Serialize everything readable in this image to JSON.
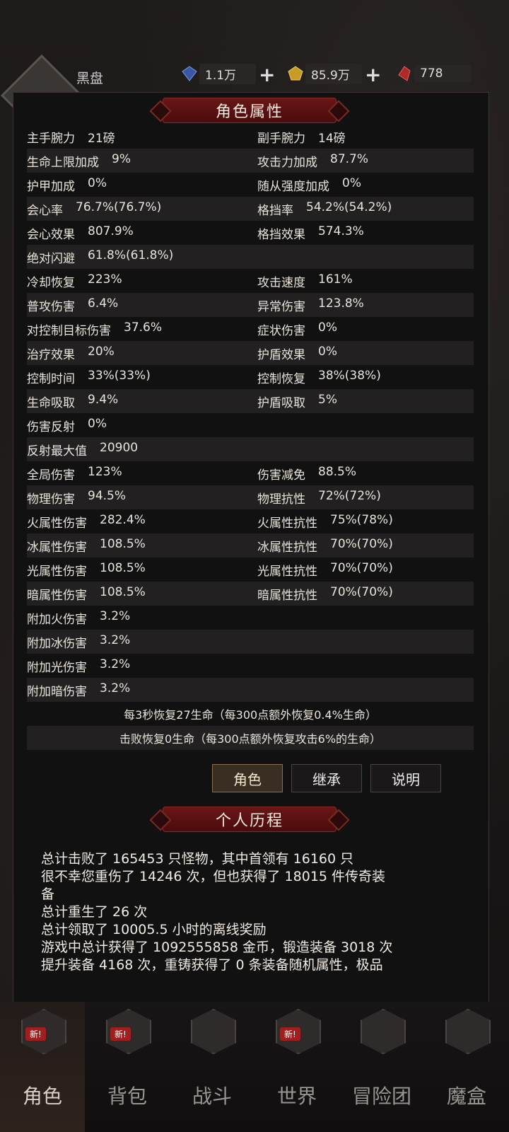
{
  "header": {
    "player_name": "黑盘",
    "currency": [
      {
        "icon": "blue-gem-icon",
        "value": "1.1万"
      },
      {
        "icon": "gold-coin-icon",
        "value": "85.9万"
      },
      {
        "icon": "red-gem-icon",
        "value": "778"
      }
    ]
  },
  "attributes_title": "角色属性",
  "stats": [
    {
      "l": "主手腕力",
      "lv": "21磅",
      "r": "副手腕力",
      "rv": "14磅"
    },
    {
      "l": "生命上限加成",
      "lv": "9%",
      "r": "攻击力加成",
      "rv": "87.7%"
    },
    {
      "l": "护甲加成",
      "lv": "0%",
      "r": "随从强度加成",
      "rv": "0%"
    },
    {
      "l": "会心率",
      "lv": "76.7%(76.7%)",
      "r": "格挡率",
      "rv": "54.2%(54.2%)"
    },
    {
      "l": "会心效果",
      "lv": "807.9%",
      "r": "格挡效果",
      "rv": "574.3%"
    },
    {
      "l": "绝对闪避",
      "lv": "61.8%(61.8%)",
      "r": "",
      "rv": ""
    },
    {
      "l": "冷却恢复",
      "lv": "223%",
      "r": "攻击速度",
      "rv": "161%"
    },
    {
      "l": "普攻伤害",
      "lv": "6.4%",
      "r": "异常伤害",
      "rv": "123.8%"
    },
    {
      "l": "对控制目标伤害",
      "lv": "37.6%",
      "r": "症状伤害",
      "rv": "0%"
    },
    {
      "l": "治疗效果",
      "lv": "20%",
      "r": "护盾效果",
      "rv": "0%"
    },
    {
      "l": "控制时间",
      "lv": "33%(33%)",
      "r": "控制恢复",
      "rv": "38%(38%)"
    },
    {
      "l": "生命吸取",
      "lv": "9.4%",
      "r": "护盾吸取",
      "rv": "5%"
    },
    {
      "l": "伤害反射",
      "lv": "0%",
      "r": "",
      "rv": ""
    },
    {
      "l": "反射最大值",
      "lv": "20900",
      "r": "",
      "rv": ""
    },
    {
      "l": "全局伤害",
      "lv": "123%",
      "r": "伤害减免",
      "rv": "88.5%"
    },
    {
      "l": "物理伤害",
      "lv": "94.5%",
      "r": "物理抗性",
      "rv": "72%(72%)"
    },
    {
      "l": "火属性伤害",
      "lv": "282.4%",
      "r": "火属性抗性",
      "rv": "75%(78%)"
    },
    {
      "l": "冰属性伤害",
      "lv": "108.5%",
      "r": "冰属性抗性",
      "rv": "70%(70%)"
    },
    {
      "l": "光属性伤害",
      "lv": "108.5%",
      "r": "光属性抗性",
      "rv": "70%(70%)"
    },
    {
      "l": "暗属性伤害",
      "lv": "108.5%",
      "r": "暗属性抗性",
      "rv": "70%(70%)"
    },
    {
      "l": "附加火伤害",
      "lv": "3.2%",
      "r": "",
      "rv": ""
    },
    {
      "l": "附加冰伤害",
      "lv": "3.2%",
      "r": "",
      "rv": ""
    },
    {
      "l": "附加光伤害",
      "lv": "3.2%",
      "r": "",
      "rv": ""
    },
    {
      "l": "附加暗伤害",
      "lv": "3.2%",
      "r": "",
      "rv": ""
    }
  ],
  "regen_lines": [
    "每3秒恢复27生命（每300点额外恢复0.4%生命）",
    "击败恢复0生命（每300点额外恢复攻击6%的生命）"
  ],
  "tabs": [
    "角色",
    "继承",
    "说明"
  ],
  "history_title": "个人历程",
  "history": [
    "总计击败了 165453 只怪物，其中首领有 16160 只",
    "很不幸您重伤了 14246 次，但也获得了 18015 件传奇装",
    "备",
    "总计重生了 26 次",
    "总计领取了 10005.5 小时的离线奖励",
    "游戏中总计获得了 1092555858 金币，锻造装备 3018 次",
    "提升装备 4168 次，重铸获得了 0 条装备随机属性，极品"
  ],
  "nav": [
    {
      "label": "角色",
      "icon": "helmet-icon",
      "badge": "新!"
    },
    {
      "label": "背包",
      "icon": "backpack-icon",
      "badge": "新!"
    },
    {
      "label": "战斗",
      "icon": "sword-shield-icon",
      "badge": ""
    },
    {
      "label": "世界",
      "icon": "scroll-map-icon",
      "badge": "新!"
    },
    {
      "label": "冒险团",
      "icon": "castle-icon",
      "badge": ""
    },
    {
      "label": "魔盒",
      "icon": "cube-icon",
      "badge": ""
    }
  ]
}
